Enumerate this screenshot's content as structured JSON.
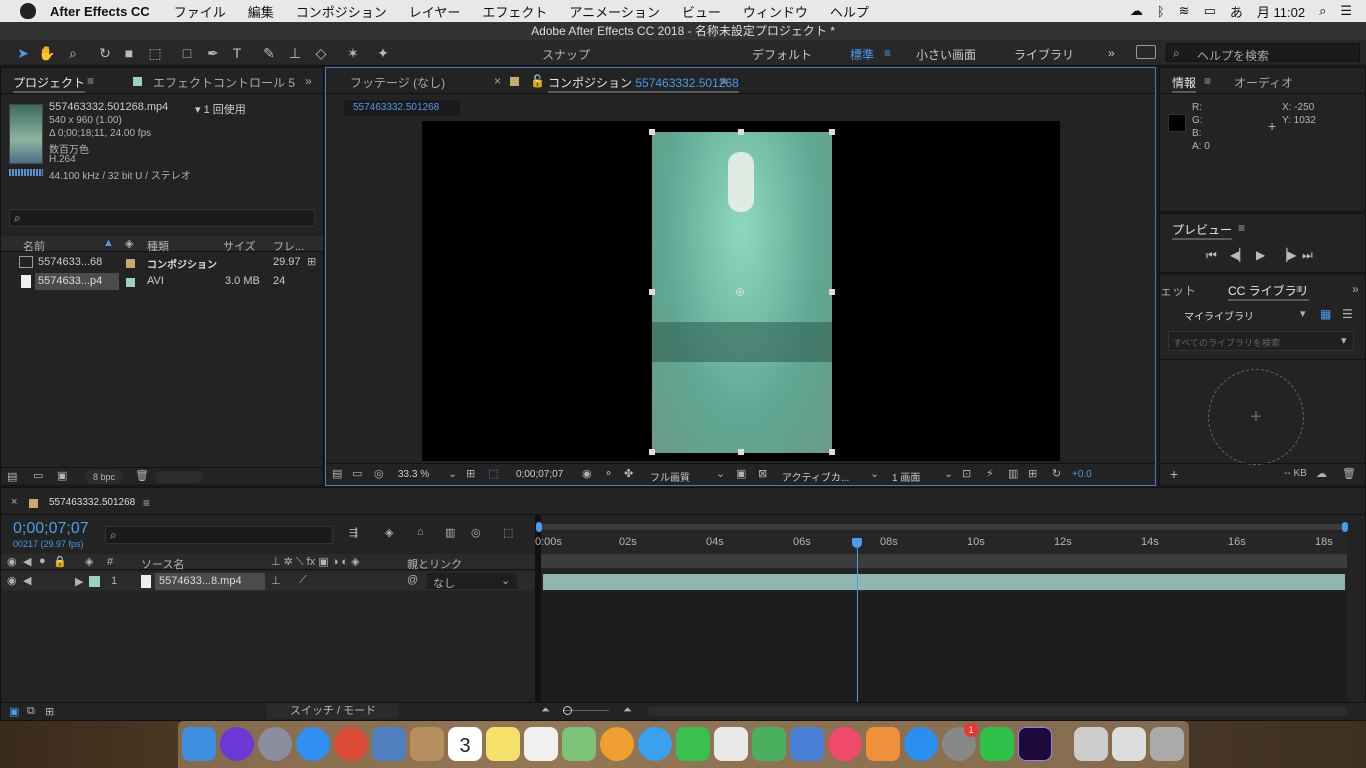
{
  "menubar": {
    "app": "After Effects CC",
    "items": [
      "ファイル",
      "編集",
      "コンポジション",
      "レイヤー",
      "エフェクト",
      "アニメーション",
      "ビュー",
      "ウィンドウ",
      "ヘルプ"
    ],
    "ime": "あ",
    "clock": "月 11:02"
  },
  "window_title": "Adobe After Effects CC 2018 - 名称未設定プロジェクト *",
  "toolbar": {
    "snap_label": "スナップ",
    "workspaces": [
      "デフォルト",
      "標準",
      "小さい画面",
      "ライブラリ"
    ],
    "help_search_placeholder": "ヘルプを検索"
  },
  "project": {
    "tab": "プロジェクト",
    "effects_tab": "エフェクトコントロール 5",
    "file_name": "557463332.501268.mp4",
    "usage": "▾ 1 回使用",
    "dims": "540 x 960 (1.00)",
    "duration": "Δ 0;00;18;11, 24.00 fps",
    "colors": "数百万色",
    "codec": "H.264",
    "audio": "44.100 kHz / 32 bit U / ステレオ",
    "search_placeholder": "",
    "columns": [
      "名前",
      "種類",
      "サイズ",
      "フレ..."
    ],
    "items": [
      {
        "name": "5574633...68",
        "type": "コンポジション",
        "size": "",
        "fps": "29.97"
      },
      {
        "name": "5574633...p4",
        "type": "AVI",
        "size": "3.0 MB",
        "fps": "24"
      }
    ],
    "bpc": "8 bpc"
  },
  "viewer": {
    "footage_tab": "フッテージ (なし)",
    "comp_tab_prefix": "コンポジション",
    "comp_name": "557463332.501268",
    "comp_chip": "557463332.501268",
    "zoom": "33.3 %",
    "timecode": "0;00;07;07",
    "quality": "フル画質",
    "camera": "アクティブカ...",
    "views": "1 画面",
    "exposure": "+0.0"
  },
  "info": {
    "tab": "情報",
    "audio_tab": "オーディオ",
    "r": "R:",
    "g": "G:",
    "b": "B:",
    "a": "A:  0",
    "x": "X:  -250",
    "y": "Y:  1032"
  },
  "preview": {
    "tab": "プレビュー"
  },
  "libraries": {
    "tab_left": "ェット",
    "tab": "CC ライブラリ",
    "my_library": "マイライブラリ",
    "search_placeholder": "すべてのライブラリを検索",
    "size": "-- KB"
  },
  "timeline": {
    "comp_name": "557463332.501268",
    "timecode": "0;00;07;07",
    "frames": "00217 (29.97 fps)",
    "col_source": "ソース名",
    "col_parent": "親とリンク",
    "col_num": "#",
    "layer_num": "1",
    "layer_name": "5574633...8.mp4",
    "parent_value": "なし",
    "switch_mode": "スイッチ / モード",
    "ruler": [
      "0:00s",
      "02s",
      "04s",
      "06s",
      "08s",
      "10s",
      "12s",
      "14s",
      "16s",
      "18s"
    ]
  },
  "dock": {
    "calendar_day": "3",
    "badge": "1"
  },
  "colors": {
    "accent": "#4a9cf0",
    "panel": "#232323",
    "footage": "#6fb7a4",
    "layer_bar": "#8fb6b0"
  }
}
